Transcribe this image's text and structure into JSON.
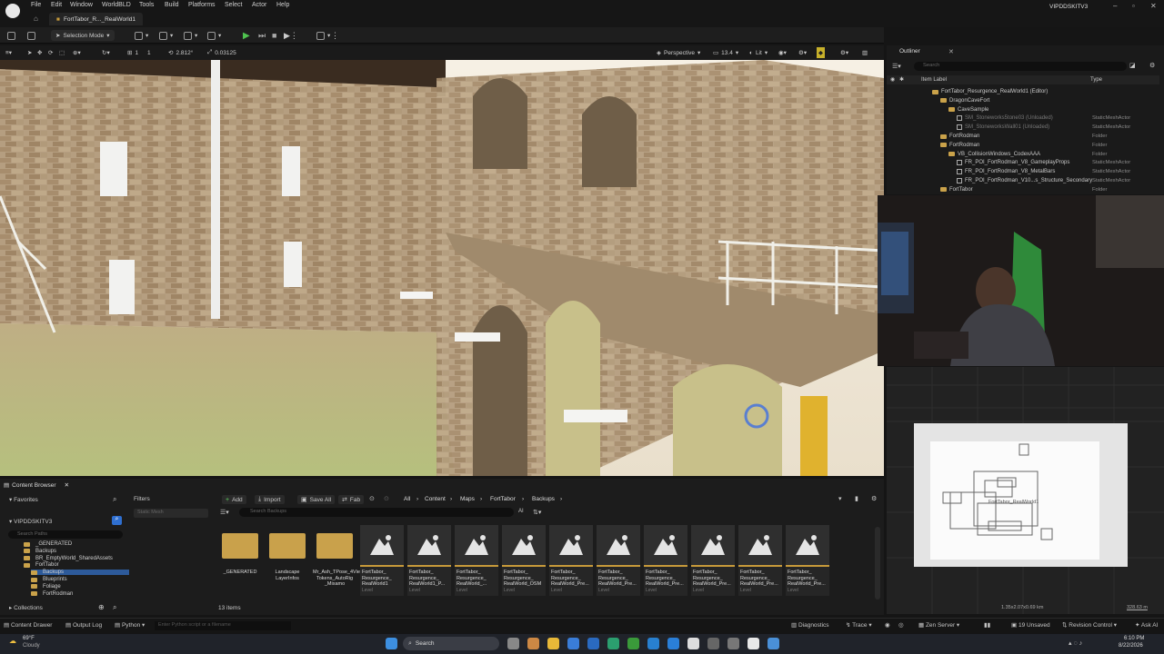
{
  "menu": [
    "File",
    "Edit",
    "Window",
    "WorldBLD",
    "Tools",
    "Build",
    "Platforms",
    "Select",
    "Actor",
    "Help"
  ],
  "level_tab": "FortTabor_R..._RealWorld1",
  "project_name": "VIPDDSKITV3",
  "toolbar": {
    "selection_mode": "Selection Mode"
  },
  "viewport_toolbar": {
    "grid": "1",
    "rotation": "2.812°",
    "scale": "0.03125",
    "perspective": "Perspective",
    "speed": "13.4",
    "lit": "Lit"
  },
  "outliner": {
    "title": "Outliner",
    "search_placeholder": "Search",
    "col_label": "Item Label",
    "col_type": "Type",
    "rows": [
      {
        "label": "FortTabor_Resurgence_RealWorld1 (Editor)",
        "type": "",
        "kind": "world",
        "indent": 0
      },
      {
        "label": "DragonCaveFort",
        "type": "",
        "kind": "folder",
        "indent": 1
      },
      {
        "label": "CaveSample",
        "type": "",
        "kind": "folder",
        "indent": 2
      },
      {
        "label": "SM_Stoneworks5tone03 (Unloaded)",
        "type": "StaticMeshActor",
        "kind": "mesh",
        "indent": 3
      },
      {
        "label": "SM_StoneworksWall01 (Unloaded)",
        "type": "StaticMeshActor",
        "kind": "mesh",
        "indent": 3
      },
      {
        "label": "FortRodman",
        "type": "Folder",
        "kind": "folder",
        "indent": 1
      },
      {
        "label": "FortRodman",
        "type": "Folder",
        "kind": "folder",
        "indent": 1
      },
      {
        "label": "VB_CollisionWindows_CodexAAA",
        "type": "Folder",
        "kind": "folder",
        "indent": 2
      },
      {
        "label": "FR_POI_FortRodman_V8_GameplayProps",
        "type": "StaticMeshActor",
        "kind": "mesh",
        "indent": 3
      },
      {
        "label": "FR_POI_FortRodman_V8_MetalBars",
        "type": "StaticMeshActor",
        "kind": "mesh",
        "indent": 3
      },
      {
        "label": "FR_POI_FortRodman_V10...s_Structure_Secondary",
        "type": "StaticMeshActor",
        "kind": "mesh",
        "indent": 3
      },
      {
        "label": "FortTabor",
        "type": "Folder",
        "kind": "folder",
        "indent": 1
      }
    ]
  },
  "content_browser": {
    "tab": "Content Browser",
    "favorites": "Favorites",
    "filters": "Filters",
    "filter_chip": "Static Mesh",
    "root": "VIPDDSKITV3",
    "search_paths_placeholder": "Search Paths",
    "folders": [
      "_GENERATED",
      "Backups",
      "BR_EmptyWorld_SharedAssets",
      "FortTabor",
      "Backups",
      "Blueprints",
      "Foliage",
      "FortRodman"
    ],
    "collections": "Collections",
    "add": "Add",
    "import": "Import",
    "save_all": "Save All",
    "fab": "Fab",
    "breadcrumb": [
      "All",
      "Content",
      "Maps",
      "FortTabor",
      "Backups"
    ],
    "search_placeholder": "Search Backups",
    "items": [
      {
        "name": "_GENERATED",
        "kind": "folder",
        "sub": ""
      },
      {
        "name": "Landscape LayerInfos",
        "kind": "folder",
        "sub": ""
      },
      {
        "name": "Mr_Ash_TPose_4View_2K_Skin Tokens_AutoRig _Mixamo",
        "kind": "folder",
        "sub": ""
      },
      {
        "name": "FortTabor_ Resurgence_ RealWorld1",
        "kind": "asset",
        "sub": "Level"
      },
      {
        "name": "FortTabor_ Resurgence_ RealWorld1_P...",
        "kind": "asset",
        "sub": "Level"
      },
      {
        "name": "FortTabor_ Resurgence_ RealWorld_...",
        "kind": "asset",
        "sub": "Level"
      },
      {
        "name": "FortTabor_ Resurgence_ RealWorld_OSM",
        "kind": "asset",
        "sub": "Level"
      },
      {
        "name": "FortTabor_ Resurgence_ RealWorld_Pre...",
        "kind": "asset",
        "sub": "Level"
      },
      {
        "name": "FortTabor_ Resurgence_ RealWorld_Pre...",
        "kind": "asset",
        "sub": "Level"
      },
      {
        "name": "FortTabor_ Resurgence_ RealWorld_Pre...",
        "kind": "asset",
        "sub": "Level"
      },
      {
        "name": "FortTabor_ Resurgence_ RealWorld_Pre...",
        "kind": "asset",
        "sub": "Level"
      },
      {
        "name": "FortTabor_ Resurgence_ RealWorld_Pre...",
        "kind": "asset",
        "sub": "Level"
      },
      {
        "name": "FortTabor_ Resurgence_ RealWorld_Pre...",
        "kind": "asset",
        "sub": "Level"
      }
    ],
    "item_count": "13 items"
  },
  "minimap": {
    "label": "FortTabor_RealWorld1",
    "dims": "1.35x2.07x0.69 km",
    "scale": "328.63 m"
  },
  "statusbar": {
    "drawer": "Content Drawer",
    "output": "Output Log",
    "cmd": "Python",
    "cmd_placeholder": "Enter Python script or a filename",
    "diagnostics": "Diagnostics",
    "trace": "Trace",
    "zen": "Zen Server",
    "unsaved": "19 Unsaved",
    "revision": "Revision Control",
    "ai": "Ask AI"
  },
  "taskbar": {
    "temp": "69°F",
    "weather": "Cloudy",
    "search": "Search",
    "time": "6:10 PM",
    "date": "8/22/2026"
  }
}
